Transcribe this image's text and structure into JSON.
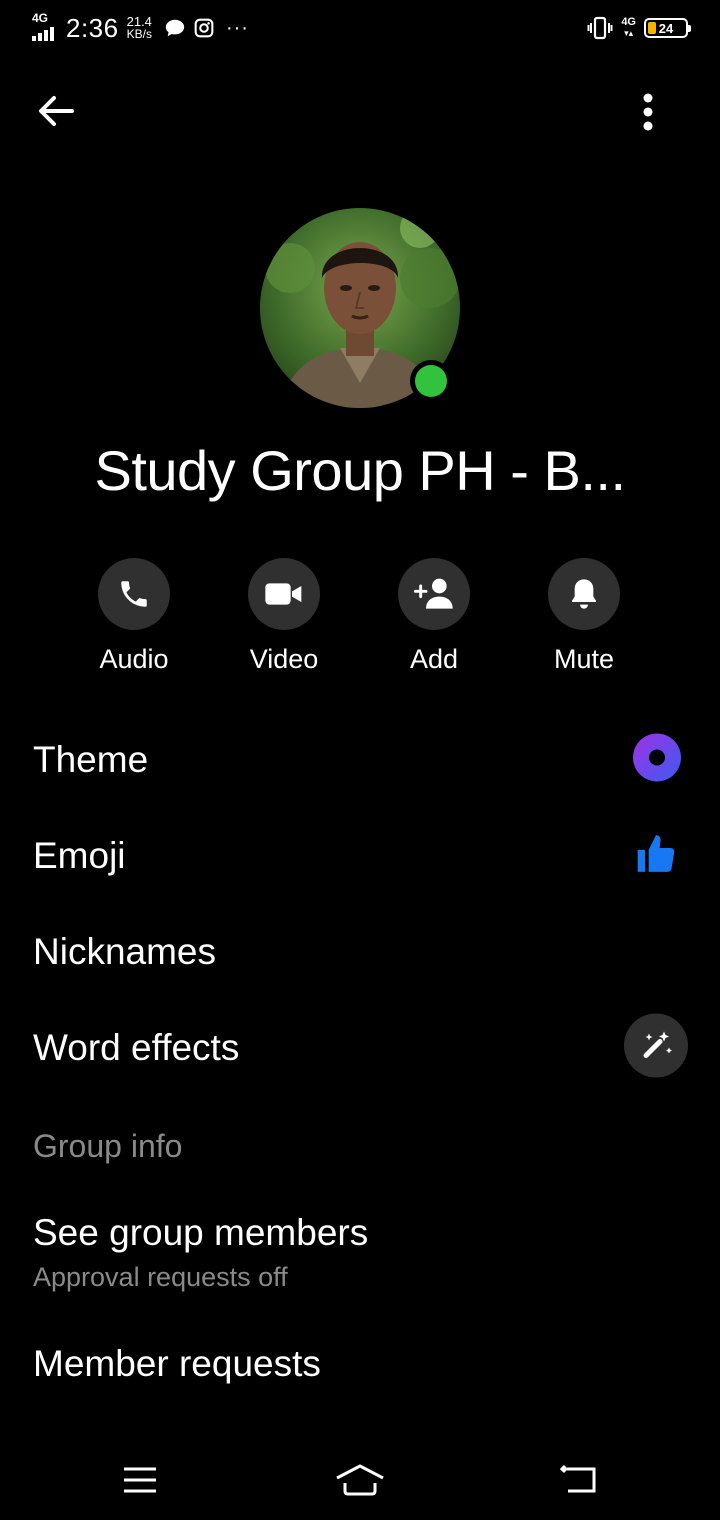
{
  "status_bar": {
    "network_label": "4G",
    "time": "2:36",
    "speed_value": "21.4",
    "speed_unit": "KB/s",
    "overflow_indicator": "···",
    "network_label_right": "4G",
    "battery_percent": "24",
    "battery_color": "#f5b400"
  },
  "header": {
    "back_icon": "arrow-left-icon",
    "more_icon": "vertical-dots-icon"
  },
  "profile": {
    "group_name": "Study Group PH - B...",
    "online_status_color": "#31c33b"
  },
  "actions": [
    {
      "label": "Audio",
      "icon": "phone-icon"
    },
    {
      "label": "Video",
      "icon": "video-camera-icon"
    },
    {
      "label": "Add",
      "icon": "add-person-icon"
    },
    {
      "label": "Mute",
      "icon": "bell-icon"
    }
  ],
  "settings": {
    "theme": {
      "label": "Theme",
      "icon": "theme-circle-icon",
      "color": "#6a3bf0"
    },
    "emoji": {
      "label": "Emoji",
      "icon": "thumbs-up-icon",
      "color": "#1877f2"
    },
    "nicknames": {
      "label": "Nicknames"
    },
    "word_effects": {
      "label": "Word effects",
      "icon": "magic-wand-icon"
    }
  },
  "group_info": {
    "header": "Group info",
    "see_members": {
      "label": "See group members",
      "subtitle": "Approval requests off"
    },
    "member_requests": {
      "label": "Member requests"
    }
  },
  "nav_bar": {
    "menu_icon": "menu-lines-icon",
    "home_icon": "home-icon",
    "back_icon": "back-return-icon"
  }
}
